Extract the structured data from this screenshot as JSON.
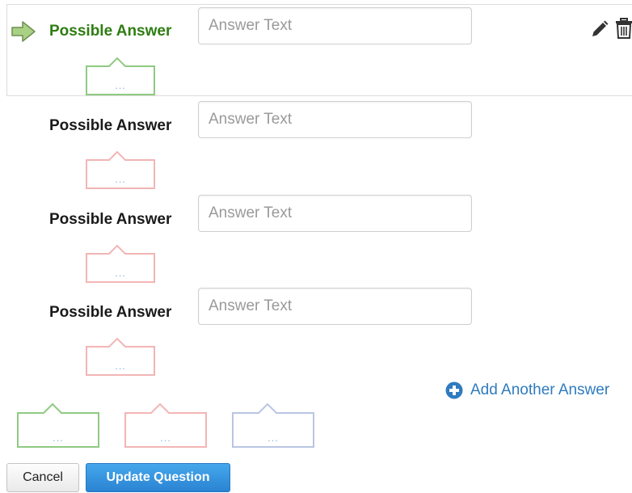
{
  "answers": [
    {
      "label": "Possible Answer",
      "value": "",
      "placeholder": "Answer Text",
      "correct": true,
      "bubble_color": "#8fca82"
    },
    {
      "label": "Possible Answer",
      "value": "",
      "placeholder": "Answer Text",
      "correct": false,
      "bubble_color": "#f3b5b5"
    },
    {
      "label": "Possible Answer",
      "value": "",
      "placeholder": "Answer Text",
      "correct": false,
      "bubble_color": "#f3b5b5"
    },
    {
      "label": "Possible Answer",
      "value": "",
      "placeholder": "Answer Text",
      "correct": false,
      "bubble_color": "#f3b5b5"
    }
  ],
  "comment_bubbles": [
    {
      "kind": "correct",
      "color": "#8fca82",
      "text": "..."
    },
    {
      "kind": "wrong",
      "color": "#f3b5b5",
      "text": "..."
    },
    {
      "kind": "neutral",
      "color": "#b9c5e3",
      "text": "..."
    }
  ],
  "add_answer_label": "Add Another Answer",
  "buttons": {
    "cancel": "Cancel",
    "update": "Update Question"
  },
  "colors": {
    "accent": "#2f7bbf",
    "correct": "#2e7d12",
    "arrow": "#a9d183"
  },
  "icons": [
    "arrow-right-icon",
    "pencil-icon",
    "trash-icon",
    "plus-circle-icon"
  ]
}
